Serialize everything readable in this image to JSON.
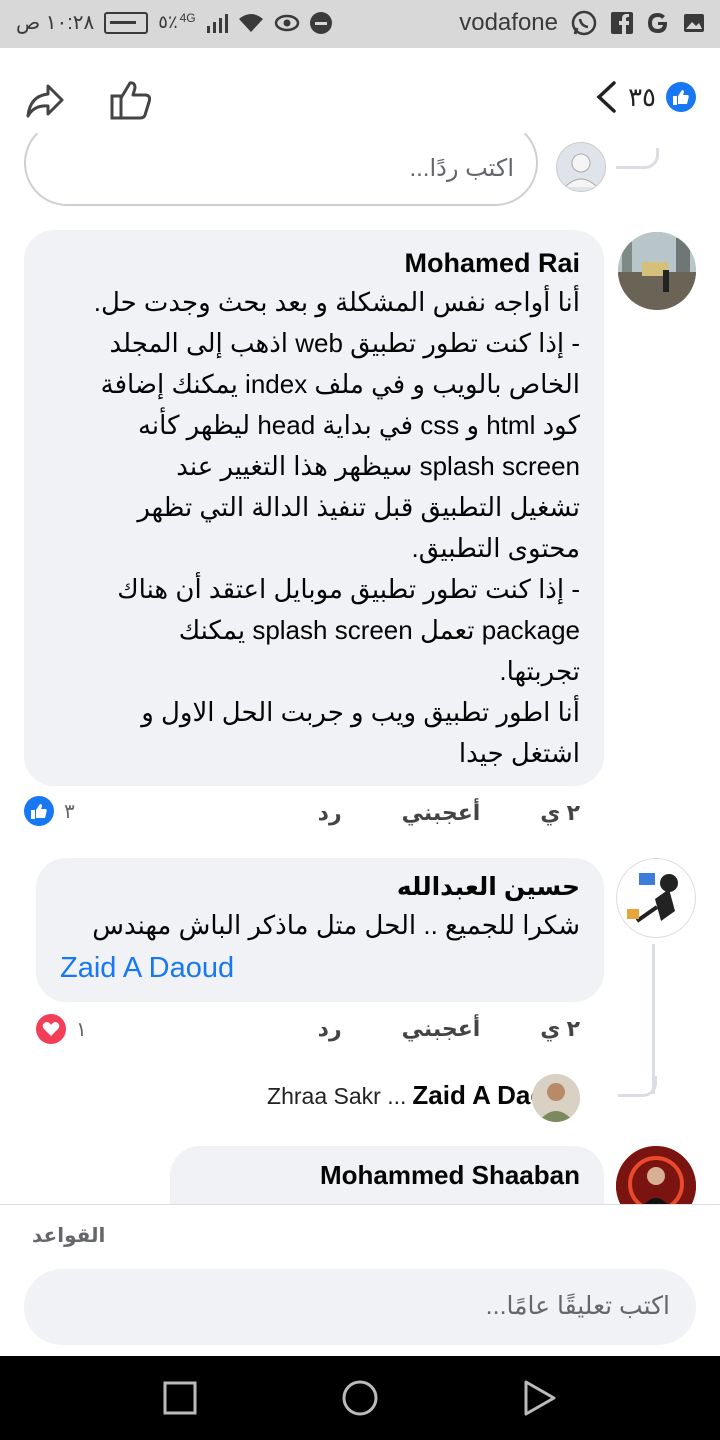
{
  "status_bar": {
    "carrier": "vodafone",
    "time": "١٠:٢٨ ص",
    "battery": "٥٪",
    "network": "4G"
  },
  "header": {
    "reactions_count": "٣٥"
  },
  "reply_box": {
    "placeholder": "اكتب ردًا..."
  },
  "comments": [
    {
      "author": "Mohamed Rai",
      "lines": [
        "أنا أواجه نفس المشكلة و بعد بحث وجدت حل.",
        "- إذا كنت تطور تطبيق web اذهب إلى المجلد",
        "الخاص بالويب و في ملف index يمكنك إضافة",
        "كود html و css في بداية head ليظهر كأنه",
        "splash screen سيظهر هذا التغيير عند",
        "تشغيل التطبيق قبل تنفيذ الدالة التي تظهر",
        "محتوى التطبيق.",
        "- إذا كنت تطور تطبيق موبايل اعتقد أن هناك",
        "package تعمل splash screen يمكنك",
        "تجربتها.",
        "أنا اطور تطبيق ويب و جربت الحل الاول و",
        "اشتغل جيدا"
      ],
      "time": "٢ ي",
      "like_label": "أعجبني",
      "reply_label": "رد",
      "reaction_count": "٣"
    },
    {
      "author": "حسين العبدالله",
      "text": "شكرا للجميع .. الحل متل ماذكر الباش مهندس",
      "mention": "Zaid A Daoud",
      "time": "٢ ي",
      "like_label": "أعجبني",
      "reply_label": "رد",
      "reaction_count": "١"
    }
  ],
  "reply_preview": {
    "author": "Zaid A Daoud",
    "snippet": "Zhraa Sakr ..."
  },
  "partial_comment": {
    "author": "Mohammed Shaaban"
  },
  "footer": {
    "rules_label": "القواعد",
    "comment_placeholder": "اكتب تعليقًا عامًا..."
  },
  "colors": {
    "facebook_blue": "#1877f2",
    "love_red": "#f33e58",
    "bubble_gray": "#f0f2f5",
    "status_bar_gray": "#d8d8d8"
  }
}
